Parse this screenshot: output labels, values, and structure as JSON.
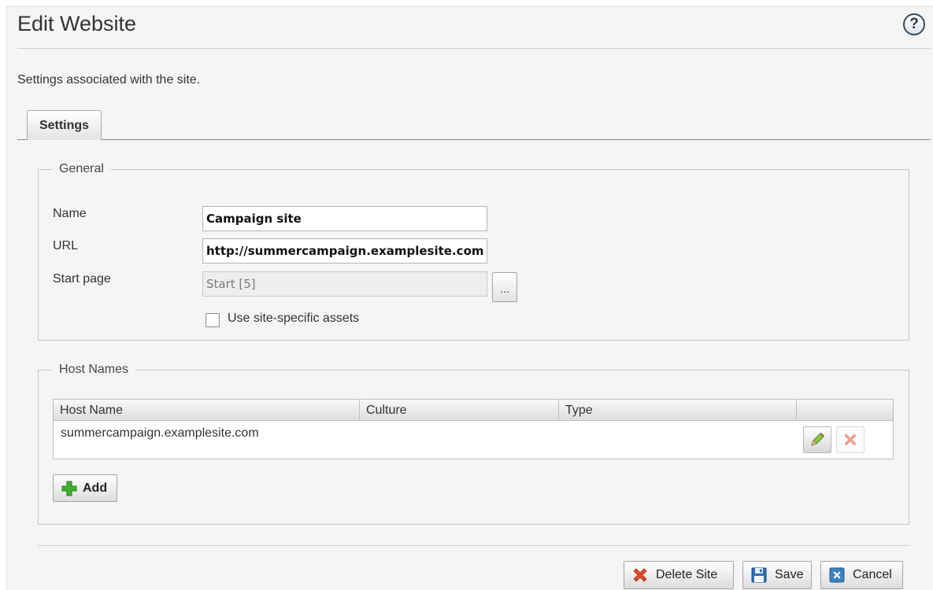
{
  "header": {
    "title": "Edit Website",
    "help_glyph": "?",
    "description": "Settings associated with the site."
  },
  "tabs": [
    {
      "label": "Settings",
      "active": true
    }
  ],
  "general": {
    "legend": "General",
    "name_label": "Name",
    "name_value": "Campaign site",
    "url_label": "URL",
    "url_value": "http://summercampaign.examplesite.com",
    "start_page_label": "Start page",
    "start_page_value": "Start [5]",
    "browse_label": "...",
    "site_assets_label": "Use site-specific assets",
    "site_assets_checked": false
  },
  "host_names": {
    "legend": "Host Names",
    "columns": [
      "Host Name",
      "Culture",
      "Type"
    ],
    "rows": [
      {
        "host_name": "summercampaign.examplesite.com",
        "culture": "",
        "type": ""
      }
    ],
    "add_label": "Add"
  },
  "actions": {
    "delete_label": "Delete Site",
    "save_label": "Save",
    "cancel_label": "Cancel"
  },
  "colors": {
    "add_icon": "#3fae2a",
    "delete_icon": "#e04b2c",
    "save_icon": "#2f6db3",
    "cancel_icon": "#3b82c4"
  }
}
